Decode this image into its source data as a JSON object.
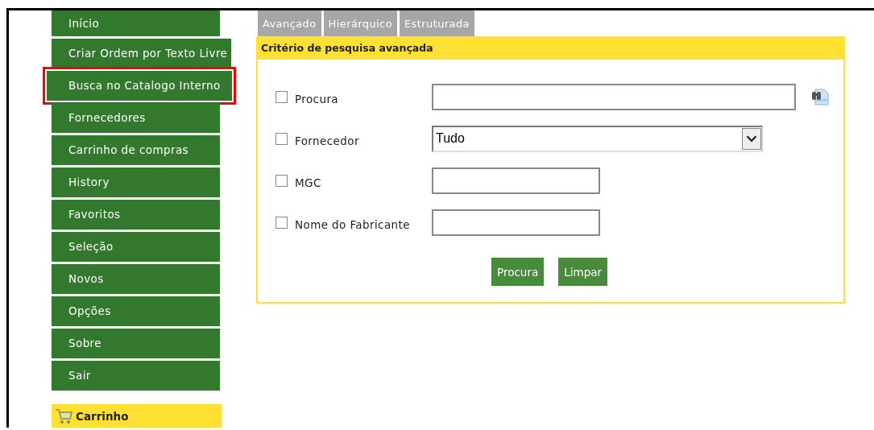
{
  "sidebar": {
    "items": [
      {
        "label": "Início",
        "highlighted": false
      },
      {
        "label": "Criar Ordem por Texto Livre",
        "highlighted": false
      },
      {
        "label": "Busca no Catalogo Interno",
        "highlighted": true
      },
      {
        "label": "Fornecedores",
        "highlighted": false
      },
      {
        "label": "Carrinho de compras",
        "highlighted": false
      },
      {
        "label": "History",
        "highlighted": false
      },
      {
        "label": "Favoritos",
        "highlighted": false
      },
      {
        "label": "Seleção",
        "highlighted": false
      },
      {
        "label": "Novos",
        "highlighted": false
      },
      {
        "label": "Opções",
        "highlighted": false
      },
      {
        "label": "Sobre",
        "highlighted": false
      },
      {
        "label": "Sair",
        "highlighted": false
      }
    ],
    "cart": {
      "title": "Carrinho"
    }
  },
  "tabs": [
    "Avançado",
    "Hierárquico",
    "Estruturada"
  ],
  "panel": {
    "title": "Critério de pesquisa avançada",
    "rows": [
      {
        "label": "Procura",
        "checked": false,
        "kind": "lookup"
      },
      {
        "label": "Fornecedor",
        "checked": false,
        "kind": "select",
        "value": "Tudo"
      },
      {
        "label": "MGC",
        "checked": false,
        "kind": "text"
      },
      {
        "label": "Nome do Fabricante",
        "checked": false,
        "kind": "text"
      }
    ],
    "buttons": [
      "Procura",
      "Limpar"
    ]
  }
}
